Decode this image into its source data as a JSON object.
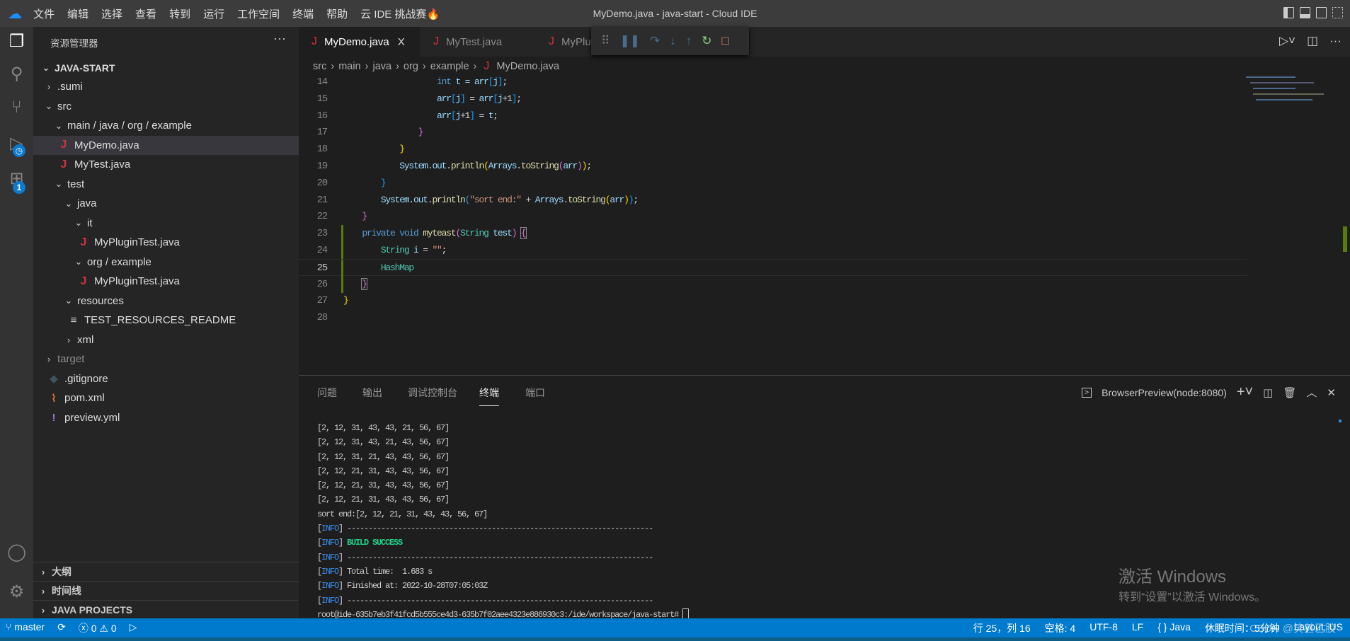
{
  "window": {
    "title": "MyDemo.java - java-start - Cloud IDE"
  },
  "menu": [
    "文件",
    "编辑",
    "选择",
    "查看",
    "转到",
    "运行",
    "工作空间",
    "终端",
    "帮助",
    "云 IDE 挑战赛🔥"
  ],
  "activity": {
    "scm_badge": "",
    "extensions_badge": "1"
  },
  "sidebar": {
    "title": "资源管理器",
    "more": "···",
    "root": "JAVA-START",
    "tree": [
      {
        "label": ".sumi",
        "indent": 1,
        "chev": "›",
        "icon": ""
      },
      {
        "label": "src",
        "indent": 1,
        "chev": "⌄",
        "icon": ""
      },
      {
        "label": "main / java / org / example",
        "indent": 2,
        "chev": "⌄",
        "icon": ""
      },
      {
        "label": "MyDemo.java",
        "indent": 2,
        "chev": "",
        "icon": "J",
        "selected": true
      },
      {
        "label": "MyTest.java",
        "indent": 2,
        "chev": "",
        "icon": "J"
      },
      {
        "label": "test",
        "indent": 2,
        "chev": "⌄",
        "icon": ""
      },
      {
        "label": "java",
        "indent": 3,
        "chev": "⌄",
        "icon": ""
      },
      {
        "label": "it",
        "indent": 4,
        "chev": "⌄",
        "icon": ""
      },
      {
        "label": "MyPluginTest.java",
        "indent": 4,
        "chev": "",
        "icon": "J"
      },
      {
        "label": "org / example",
        "indent": 4,
        "chev": "⌄",
        "icon": ""
      },
      {
        "label": "MyPluginTest.java",
        "indent": 4,
        "chev": "",
        "icon": "J"
      },
      {
        "label": "resources",
        "indent": 3,
        "chev": "⌄",
        "icon": ""
      },
      {
        "label": "TEST_RESOURCES_README",
        "indent": 3,
        "chev": "",
        "icon": "≡"
      },
      {
        "label": "xml",
        "indent": 3,
        "chev": "›",
        "icon": ""
      },
      {
        "label": "target",
        "indent": 1,
        "chev": "›",
        "icon": "",
        "dim": true
      },
      {
        "label": ".gitignore",
        "indent": 1,
        "chev": "",
        "icon": "◆"
      },
      {
        "label": "pom.xml",
        "indent": 1,
        "chev": "",
        "icon": "⌇"
      },
      {
        "label": "preview.yml",
        "indent": 1,
        "chev": "",
        "icon": "!"
      }
    ],
    "sections": [
      "大纲",
      "时间线",
      "JAVA PROJECTS"
    ]
  },
  "tabs": [
    {
      "label": "MyDemo.java",
      "active": true,
      "close": "X"
    },
    {
      "label": "MyTest.java"
    },
    {
      "label": "MyPlu"
    }
  ],
  "breadcrumb": [
    "src",
    "main",
    "java",
    "org",
    "example",
    "MyDemo.java"
  ],
  "editor": {
    "current_line": 25,
    "lines": [
      {
        "n": 14,
        "t": [
          [
            "                    ",
            "pl"
          ],
          [
            "int",
            "kw"
          ],
          [
            " t = ",
            "va"
          ],
          [
            "arr",
            "va"
          ],
          [
            "[",
            "b3"
          ],
          [
            "j",
            "va"
          ],
          [
            "]",
            "b3"
          ],
          [
            ";",
            "pl"
          ]
        ]
      },
      {
        "n": 15,
        "t": [
          [
            "                    ",
            "pl"
          ],
          [
            "arr",
            "va"
          ],
          [
            "[",
            "b3"
          ],
          [
            "j",
            "va"
          ],
          [
            "]",
            "b3"
          ],
          [
            " = ",
            "pl"
          ],
          [
            "arr",
            "va"
          ],
          [
            "[",
            "b3"
          ],
          [
            "j",
            "va"
          ],
          [
            "+1",
            "pl"
          ],
          [
            "]",
            "b3"
          ],
          [
            ";",
            "pl"
          ]
        ]
      },
      {
        "n": 16,
        "t": [
          [
            "                    ",
            "pl"
          ],
          [
            "arr",
            "va"
          ],
          [
            "[",
            "b3"
          ],
          [
            "j",
            "va"
          ],
          [
            "+1",
            "pl"
          ],
          [
            "]",
            "b3"
          ],
          [
            " = ",
            "pl"
          ],
          [
            "t",
            "va"
          ],
          [
            ";",
            "pl"
          ]
        ]
      },
      {
        "n": 17,
        "t": [
          [
            "                ",
            "pl"
          ],
          [
            "}",
            "b2"
          ]
        ]
      },
      {
        "n": 18,
        "t": [
          [
            "            ",
            "pl"
          ],
          [
            "}",
            "b1"
          ]
        ]
      },
      {
        "n": 19,
        "t": [
          [
            "            ",
            "pl"
          ],
          [
            "System",
            "va"
          ],
          [
            ".",
            "pl"
          ],
          [
            "out",
            "va"
          ],
          [
            ".",
            "pl"
          ],
          [
            "println",
            "fn"
          ],
          [
            "(",
            "b1"
          ],
          [
            "Arrays",
            "va"
          ],
          [
            ".",
            "pl"
          ],
          [
            "toString",
            "fn"
          ],
          [
            "(",
            "b2"
          ],
          [
            "arr",
            "va"
          ],
          [
            ")",
            "b2"
          ],
          [
            ")",
            "b1"
          ],
          [
            ";",
            "pl"
          ]
        ]
      },
      {
        "n": 20,
        "t": [
          [
            "        ",
            "pl"
          ],
          [
            "}",
            "b3"
          ]
        ]
      },
      {
        "n": 21,
        "t": [
          [
            "        ",
            "pl"
          ],
          [
            "System",
            "va"
          ],
          [
            ".",
            "pl"
          ],
          [
            "out",
            "va"
          ],
          [
            ".",
            "pl"
          ],
          [
            "println",
            "fn"
          ],
          [
            "(",
            "b3"
          ],
          [
            "\"sort end:\"",
            "st"
          ],
          [
            " + ",
            "pl"
          ],
          [
            "Arrays",
            "va"
          ],
          [
            ".",
            "pl"
          ],
          [
            "toString",
            "fn"
          ],
          [
            "(",
            "b1"
          ],
          [
            "arr",
            "va"
          ],
          [
            ")",
            "b1"
          ],
          [
            ")",
            "b3"
          ],
          [
            ";",
            "pl"
          ]
        ]
      },
      {
        "n": 22,
        "t": [
          [
            "    ",
            "pl"
          ],
          [
            "}",
            "b2"
          ]
        ]
      },
      {
        "n": 23,
        "t": [
          [
            "    ",
            "pl"
          ],
          [
            "private",
            "kw"
          ],
          [
            " ",
            "pl"
          ],
          [
            "void",
            "kw"
          ],
          [
            " ",
            "pl"
          ],
          [
            "myteast",
            "fn"
          ],
          [
            "(",
            "b2"
          ],
          [
            "String",
            "ty"
          ],
          [
            " ",
            "pl"
          ],
          [
            "test",
            "va"
          ],
          [
            ")",
            "b2"
          ],
          [
            " ",
            "pl"
          ],
          [
            "{",
            "b2 bx"
          ]
        ]
      },
      {
        "n": 24,
        "t": [
          [
            "        ",
            "pl"
          ],
          [
            "String",
            "ty"
          ],
          [
            " ",
            "pl"
          ],
          [
            "i",
            "va"
          ],
          [
            " = ",
            "pl"
          ],
          [
            "\"\"",
            "st"
          ],
          [
            ";",
            "pl"
          ]
        ]
      },
      {
        "n": 25,
        "t": [
          [
            "        ",
            "pl"
          ],
          [
            "HashMap",
            "ty"
          ]
        ]
      },
      {
        "n": 26,
        "t": [
          [
            "    ",
            "pl"
          ],
          [
            "}",
            "b2 bx"
          ]
        ]
      },
      {
        "n": 27,
        "t": [
          [
            "}",
            "b1"
          ]
        ]
      },
      {
        "n": 28,
        "t": []
      }
    ]
  },
  "panel": {
    "tabs": [
      "问题",
      "输出",
      "调试控制台",
      "终端",
      "端口"
    ],
    "active_tab": "终端",
    "terminal_name": "BrowserPreview(node:8080)",
    "terminal": {
      "arrays": [
        "[2, 12, 31, 43, 43, 21, 56, 67]",
        "[2, 12, 31, 43, 21, 43, 56, 67]",
        "[2, 12, 31, 21, 43, 43, 56, 67]",
        "[2, 12, 21, 31, 43, 43, 56, 67]",
        "[2, 12, 21, 31, 43, 43, 56, 67]",
        "[2, 12, 21, 31, 43, 43, 56, 67]"
      ],
      "sort_end": "sort end:[2, 12, 21, 31, 43, 43, 56, 67]",
      "info_tag": "INFO",
      "info": [
        {
          "text": "------------------------------------------------------------------------"
        },
        {
          "text": "BUILD SUCCESS",
          "ok": true
        },
        {
          "text": "------------------------------------------------------------------------"
        },
        {
          "text": "Total time:  1.683 s"
        },
        {
          "text": "Finished at: 2022-10-28T07:05:03Z"
        },
        {
          "text": "------------------------------------------------------------------------"
        }
      ],
      "prompt": "root@ide-635b7eb3f41fcd5b555ce4d3-635b7f02aee4323e886930c3:/ide/workspace/java-start# "
    }
  },
  "watermark": {
    "line1": "激活 Windows",
    "line2": "转到“设置”以激活 Windows。"
  },
  "statusbar": {
    "branch": "master",
    "errors": "0",
    "warnings": "0",
    "position": "行 25，列 16",
    "spaces": "空格: 4",
    "encoding": "UTF-8",
    "eol": "LF",
    "language": "{ } Java",
    "idle": "休眠时间：5分钟",
    "layout": "Layout: US",
    "credit": "CSDN @笑甚乙胶"
  },
  "colors": {
    "accent": "#007acc",
    "java_icon": "#d3323c",
    "success": "#23d18b",
    "info": "#3b8eea"
  }
}
